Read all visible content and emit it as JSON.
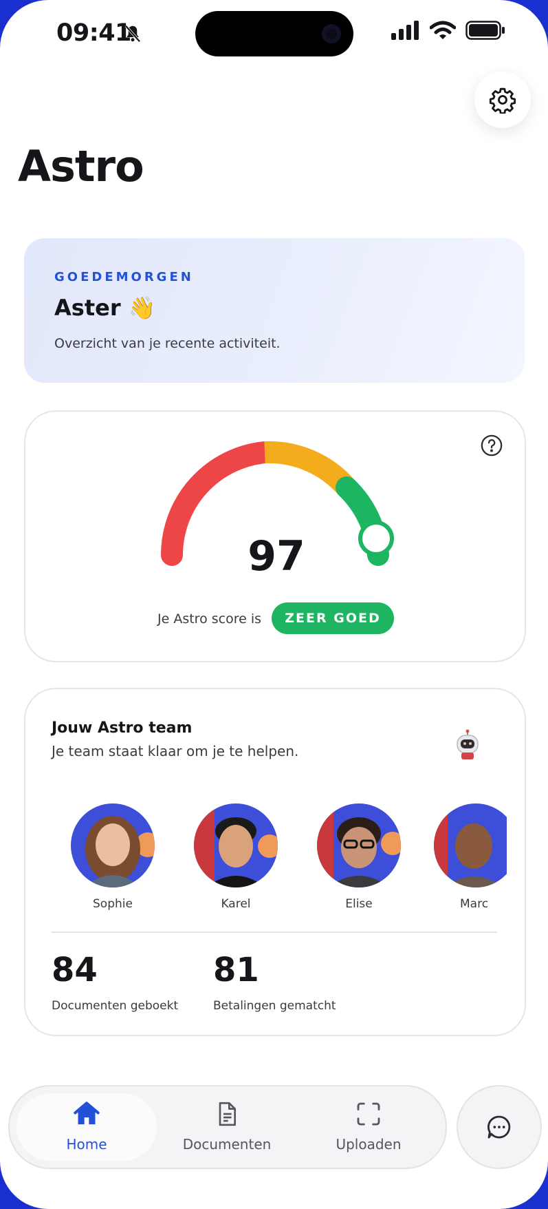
{
  "status_bar": {
    "time": "09:41"
  },
  "app": {
    "title": "Astro"
  },
  "greeting": {
    "eyebrow": "GOEDEMORGEN",
    "name": "Aster 👋",
    "subtitle": "Overzicht van je recente activiteit."
  },
  "score": {
    "value": "97",
    "label": "Je Astro score is",
    "badge": "ZEER GOED",
    "level_fraction": 0.97
  },
  "team": {
    "title": "Jouw Astro team",
    "subtitle": "Je team staat klaar om je te helpen.",
    "members": [
      {
        "name": "Sophie"
      },
      {
        "name": "Karel"
      },
      {
        "name": "Elise"
      },
      {
        "name": "Marc"
      }
    ],
    "stats": [
      {
        "value": "84",
        "label": "Documenten geboekt"
      },
      {
        "value": "81",
        "label": "Betalingen gematcht"
      }
    ]
  },
  "nav": {
    "items": [
      {
        "label": "Home",
        "icon": "home-icon",
        "active": true
      },
      {
        "label": "Documenten",
        "icon": "document-icon",
        "active": false
      },
      {
        "label": "Uploaden",
        "icon": "scan-icon",
        "active": false
      }
    ],
    "chat_icon": "chat-icon"
  },
  "colors": {
    "accent": "#2051d6",
    "good": "#1db561",
    "gauge_red": "#ee4646",
    "gauge_orange": "#f5ac1c",
    "gauge_green": "#1db561",
    "background_frame": "#1a2fd0"
  }
}
